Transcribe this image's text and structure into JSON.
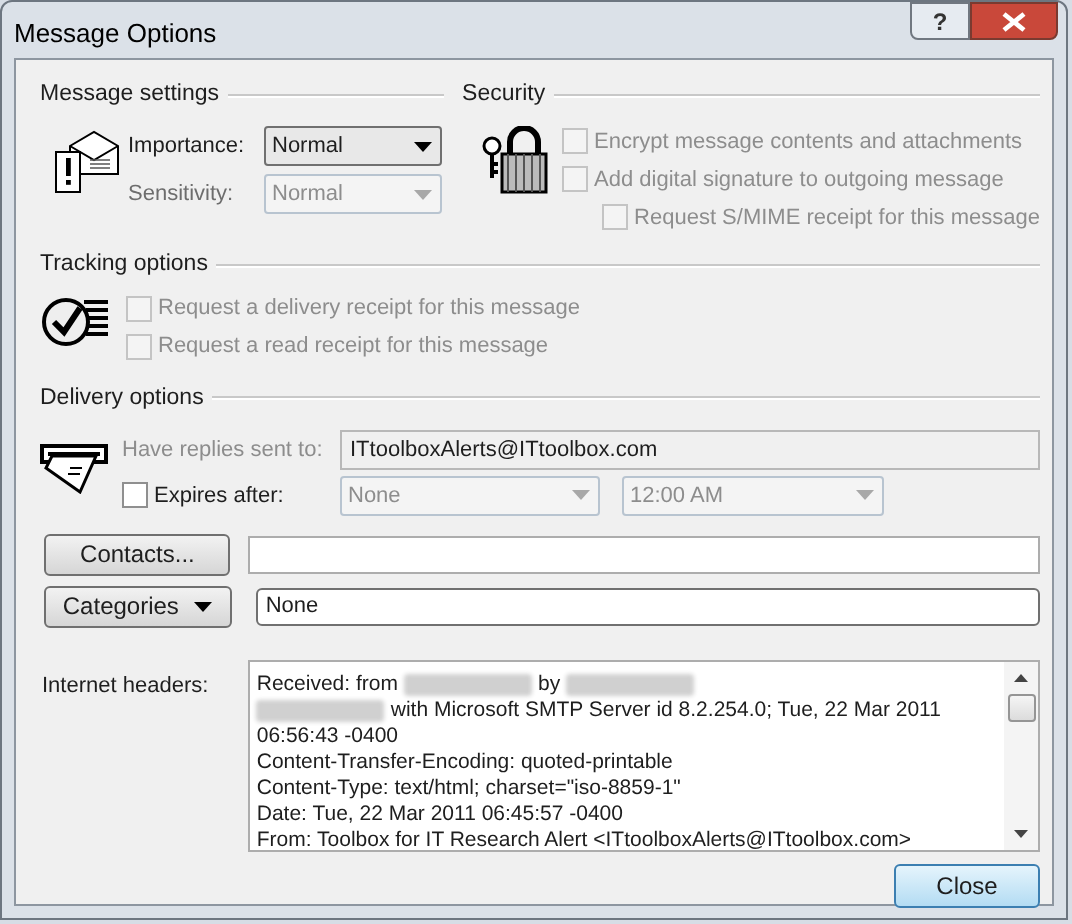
{
  "window": {
    "title": "Message Options",
    "help_button": "?"
  },
  "message_settings": {
    "title": "Message settings",
    "fields": [
      {
        "label": "Importance:",
        "value": "Normal",
        "disabled": false
      },
      {
        "label": "Sensitivity:",
        "value": "Normal",
        "disabled": true
      }
    ]
  },
  "security": {
    "title": "Security",
    "options": [
      {
        "label": "Encrypt message contents and attachments",
        "checked": false,
        "disabled": true
      },
      {
        "label": "Add digital signature to outgoing message",
        "checked": false,
        "disabled": true,
        "children": [
          {
            "label": "Request S/MIME receipt for this message",
            "checked": false,
            "disabled": true
          }
        ]
      }
    ]
  },
  "tracking": {
    "title": "Tracking options",
    "options": [
      {
        "label": "Request a delivery receipt for this message",
        "checked": false,
        "disabled": true
      },
      {
        "label": "Request a read receipt for this message",
        "checked": false,
        "disabled": true
      }
    ]
  },
  "delivery": {
    "title": "Delivery options",
    "reply_to": {
      "label": "Have replies sent to:",
      "value": "ITtoolboxAlerts@ITtoolbox.com",
      "disabled": true
    },
    "expires": {
      "label": "Expires after:",
      "checked": false,
      "date": "None",
      "time": "12:00 AM"
    },
    "contacts": {
      "button": "Contacts..."
    },
    "categories": {
      "button": "Categories",
      "value": "None"
    }
  },
  "headers": {
    "label": "Internet headers:",
    "lines": [
      [
        {
          "kind": "text",
          "text": "Received: from"
        },
        {
          "kind": "redacted"
        },
        {
          "kind": "text",
          "text": "by"
        },
        {
          "kind": "redacted"
        }
      ],
      [
        {
          "kind": "redacted"
        },
        {
          "kind": "text",
          "text": "with Microsoft SMTP Server id 8.2.254.0; Tue, 22 Mar 2011"
        }
      ],
      [
        {
          "kind": "text",
          "text": "06:56:43 -0400"
        }
      ],
      [
        {
          "kind": "text",
          "text": "Content-Transfer-Encoding: quoted-printable"
        }
      ],
      [
        {
          "kind": "text",
          "text": "Content-Type: text/html; charset=\"iso-8859-1\""
        }
      ],
      [
        {
          "kind": "text",
          "text": "Date: Tue, 22 Mar 2011 06:45:57 -0400"
        }
      ],
      [
        {
          "kind": "text",
          "text": "From: Toolbox for IT Research Alert <ITtoolboxAlerts@ITtoolbox.com>"
        }
      ]
    ]
  },
  "close_button": "Close"
}
